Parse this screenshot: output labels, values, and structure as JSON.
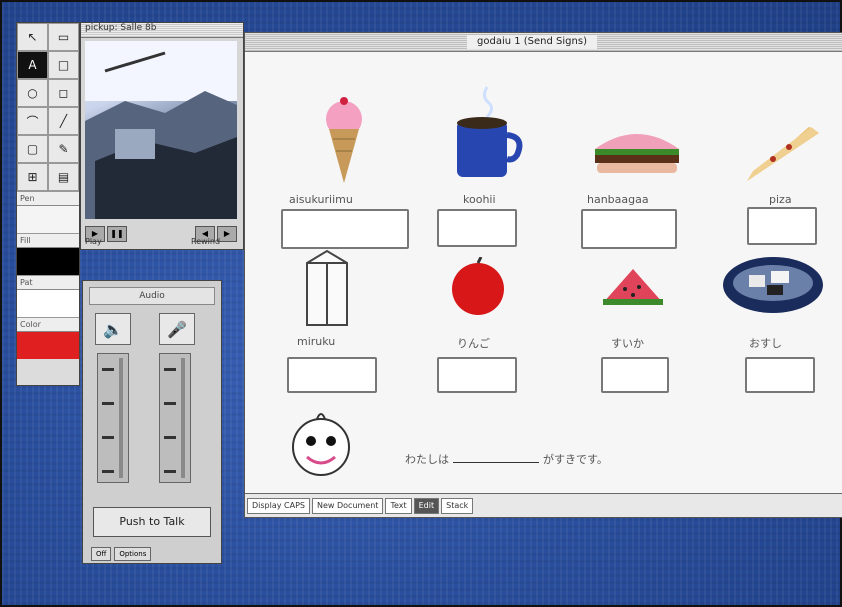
{
  "tools": {
    "buttons": [
      "↖",
      "▭",
      "A",
      "□",
      "○",
      "◻",
      "⌒",
      "╱",
      "▢",
      "✎",
      "⊞",
      "▤"
    ],
    "swatches": [
      {
        "label": "Pen"
      },
      {
        "label": "Fill",
        "color": "#000000"
      },
      {
        "label": "Pat",
        "color": "#ffffff"
      },
      {
        "label": "Color",
        "color": "#e02020"
      }
    ]
  },
  "video": {
    "title": "pickup: Salle 8b",
    "caption_left": "Play",
    "caption_right": "Rewind"
  },
  "audio": {
    "title": "Audio",
    "push_label": "Push to Talk",
    "footer": [
      "Off",
      "Options"
    ]
  },
  "lesson": {
    "title": "godaiu 1 (Send Signs)",
    "items": [
      {
        "name": "ice-cream",
        "label": "aisukuriimu"
      },
      {
        "name": "coffee",
        "label": "koohii"
      },
      {
        "name": "hamburger",
        "label": "hanbaagaa"
      },
      {
        "name": "pizza",
        "label": "piza"
      },
      {
        "name": "milk",
        "label": "miruku"
      },
      {
        "name": "apple",
        "label": "りんご"
      },
      {
        "name": "watermelon",
        "label": "すいか"
      },
      {
        "name": "sushi",
        "label": "おすし"
      }
    ],
    "sentence_left": "わたしは",
    "sentence_right": "がすきです。",
    "bottom_tabs": [
      "Display CAPS",
      "New Document",
      "Text",
      "Edit",
      "Stack"
    ]
  }
}
